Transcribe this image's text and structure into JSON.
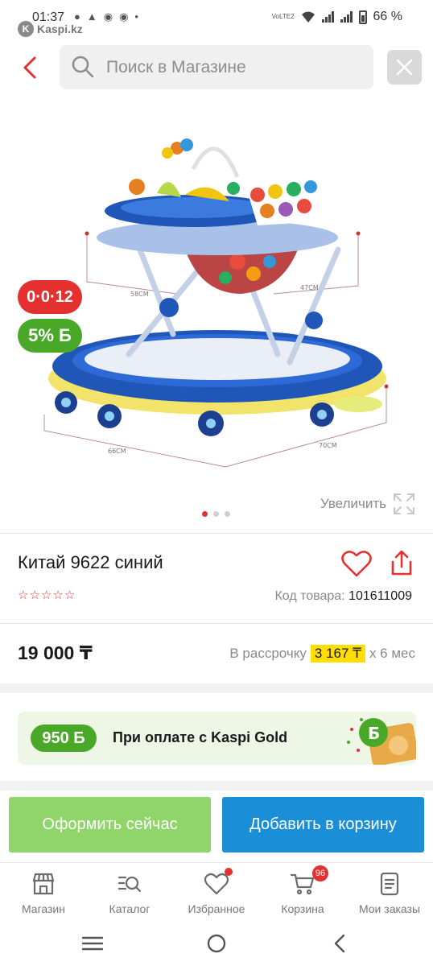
{
  "status_bar": {
    "time": "01:37",
    "network_label": "VoLTE2",
    "battery": "66 %",
    "app_brand": "Kaspi.kz"
  },
  "search": {
    "placeholder": "Поиск в Магазине"
  },
  "product": {
    "badge_installment": "0·0·12",
    "badge_bonus": "5% Б",
    "zoom_label": "Увеличить",
    "gallery_count": 3,
    "gallery_active": 0,
    "title": "Китай 9622 синий",
    "rating_stars": 0,
    "sku_label": "Код товара:",
    "sku": "101611009",
    "price": "19 000 ₸",
    "installment_prefix": "В рассрочку",
    "installment_amount": "3 167 ₸",
    "installment_suffix": "х 6 мес"
  },
  "gold_banner": {
    "bonus": "950 Б",
    "text": "При оплате с Kaspi Gold"
  },
  "actions": {
    "checkout": "Оформить сейчас",
    "add_to_cart": "Добавить в корзину"
  },
  "bottom_nav": {
    "items": [
      {
        "label": "Магазин",
        "icon": "shop-icon"
      },
      {
        "label": "Каталог",
        "icon": "catalog-search-icon"
      },
      {
        "label": "Избранное",
        "icon": "heart-icon"
      },
      {
        "label": "Корзина",
        "icon": "cart-icon",
        "count": "96"
      },
      {
        "label": "Мои заказы",
        "icon": "orders-icon"
      }
    ]
  },
  "colors": {
    "accent_red": "#e4312f",
    "kaspi_green": "#4aa828",
    "button_blue": "#1a8fd8",
    "button_green": "#90d569",
    "highlight_yellow": "#ffde00"
  }
}
